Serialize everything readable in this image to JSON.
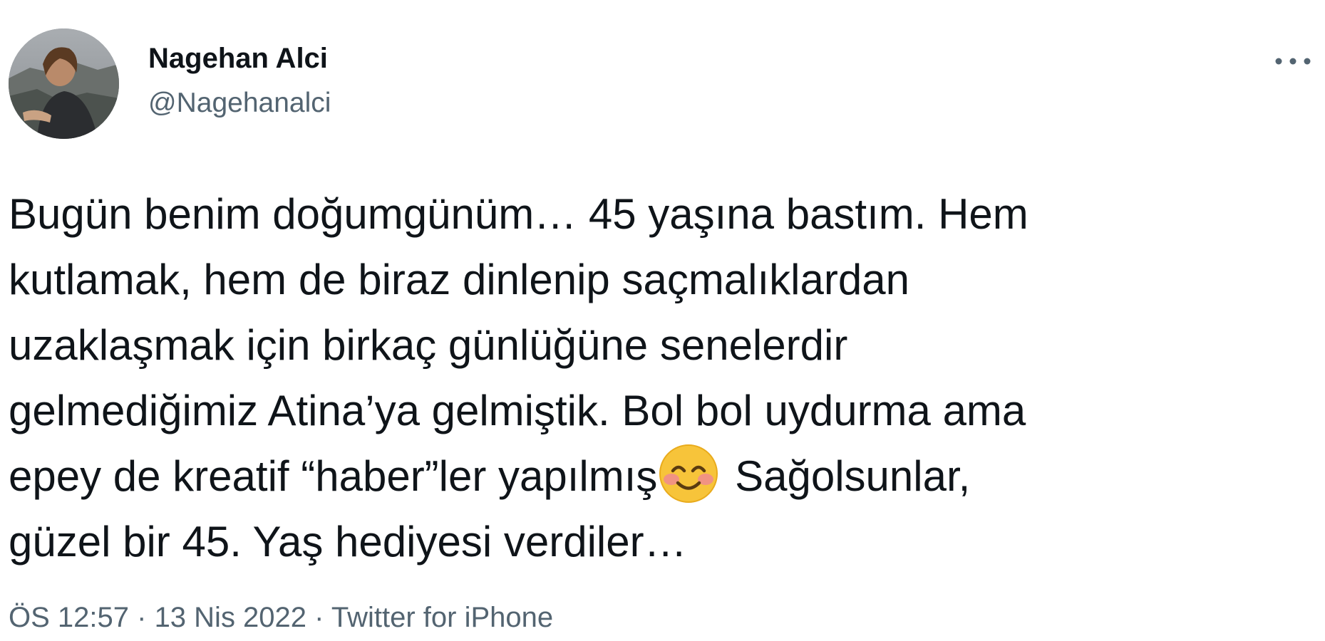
{
  "author": {
    "display_name": "Nagehan Alci",
    "handle": "@Nagehanalci",
    "avatar_icon": "profile-photo-avatar"
  },
  "more_icon": "more-options-icon",
  "tweet": {
    "lines": {
      "l1": "Bugün benim doğumgünüm… 45 yaşına bastım. Hem",
      "l2": "kutlamak, hem de biraz dinlenip saçmalıklardan",
      "l3": "uzaklaşmak için birkaç günlüğüne senelerdir",
      "l4": "gelmediğimiz Atina’ya gelmiştik. Bol bol uydurma ama",
      "l5_before": "epey de kreatif “haber”ler yapılmış",
      "l5_after": " Sağolsunlar,",
      "l6": "güzel bir 45. Yaş hediyesi verdiler…"
    },
    "emoji_icon": "smiling-face-with-smiling-eyes-emoji"
  },
  "meta": {
    "time": "ÖS 12:57",
    "separator": " · ",
    "date": "13 Nis 2022",
    "source": "Twitter for iPhone"
  },
  "colors": {
    "text_primary": "#0f1419",
    "text_secondary": "#536471"
  }
}
